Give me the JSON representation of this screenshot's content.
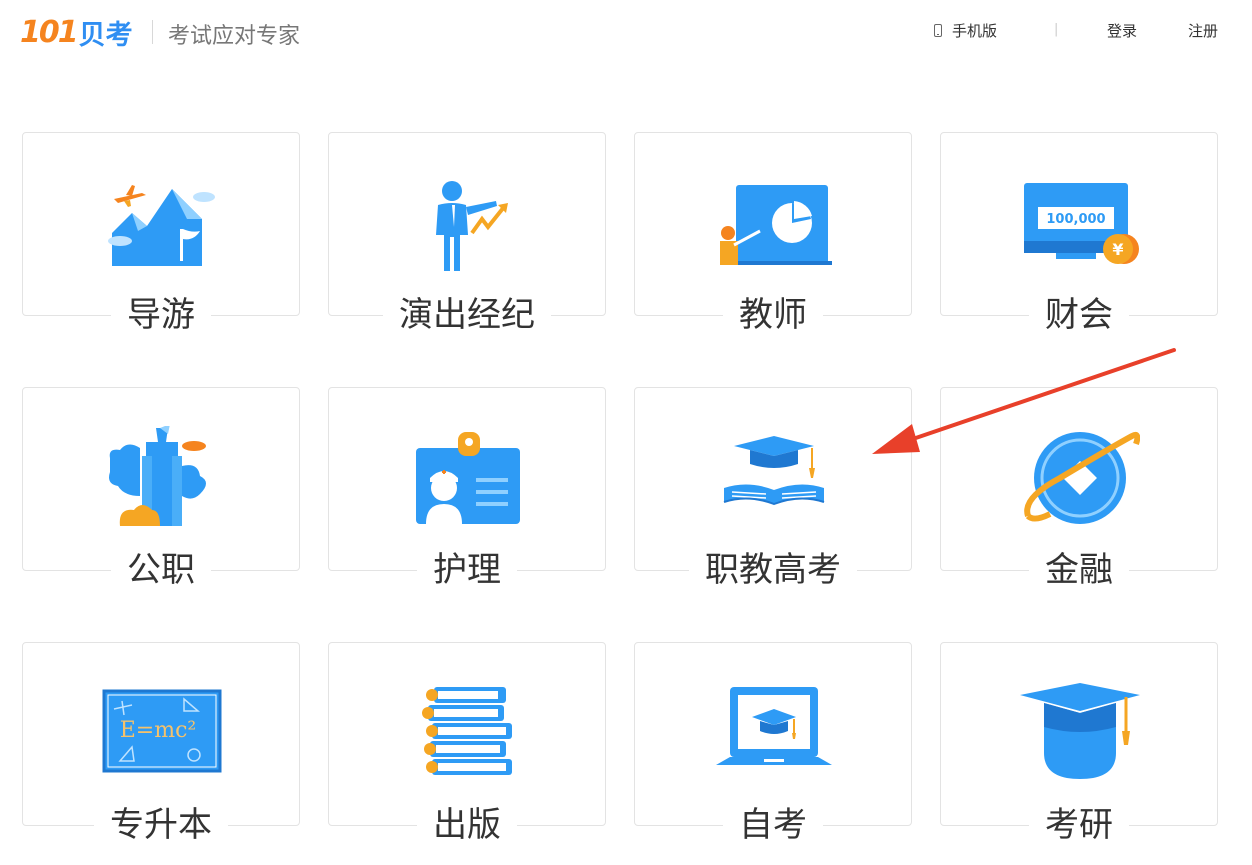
{
  "header": {
    "logo_num": "101",
    "logo_text": "贝考",
    "slogan": "考试应对专家",
    "nav": {
      "mobile": "手机版",
      "separator": "|",
      "login": "登录",
      "register": "注册"
    }
  },
  "categories": [
    {
      "label": "导游",
      "icon": "mountain-plane-icon"
    },
    {
      "label": "演出经纪",
      "icon": "presenter-chart-icon"
    },
    {
      "label": "教师",
      "icon": "teacher-board-icon"
    },
    {
      "label": "财会",
      "icon": "money-monitor-icon"
    },
    {
      "label": "公职",
      "icon": "tower-icon"
    },
    {
      "label": "护理",
      "icon": "nurse-badge-icon"
    },
    {
      "label": "职教高考",
      "icon": "cap-book-icon"
    },
    {
      "label": "金融",
      "icon": "globe-orbit-icon"
    },
    {
      "label": "专升本",
      "icon": "formula-board-icon"
    },
    {
      "label": "出版",
      "icon": "book-stack-icon"
    },
    {
      "label": "自考",
      "icon": "laptop-cap-icon"
    },
    {
      "label": "考研",
      "icon": "graduation-cap-icon"
    }
  ],
  "texts": {
    "money": "100,000",
    "yen": "¥",
    "formula": "E=mc²"
  },
  "colors": {
    "brand_orange": "#f5841f",
    "brand_blue": "#2f8ef2",
    "icon_blue": "#2e9bf5",
    "icon_orange": "#f5a623",
    "arrow_red": "#e8402a"
  }
}
